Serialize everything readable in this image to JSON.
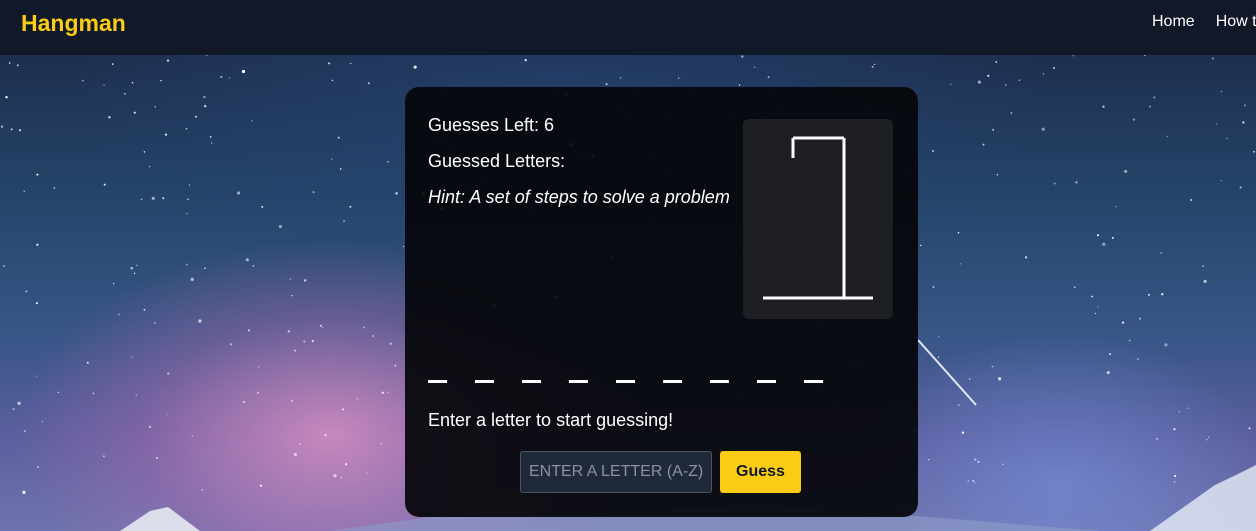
{
  "navbar": {
    "brand": "Hangman",
    "links": [
      "Home",
      "How t"
    ]
  },
  "game": {
    "guesses_left": "Guesses Left: 6",
    "guessed_letters": "Guessed Letters:",
    "hint": "Hint: A set of steps to solve a problem",
    "blanks": [
      "_",
      "_",
      "_",
      "_",
      "_",
      "_",
      "_",
      "_",
      "_"
    ],
    "message": "Enter a letter to start guessing!",
    "input": {
      "placeholder": "ENTER A LETTER (A-Z)",
      "value": ""
    },
    "guess_label": "Guess"
  },
  "colors": {
    "brand": "#facc15",
    "navbar": "#111827",
    "card": "#05060a",
    "button": "#facc15"
  }
}
